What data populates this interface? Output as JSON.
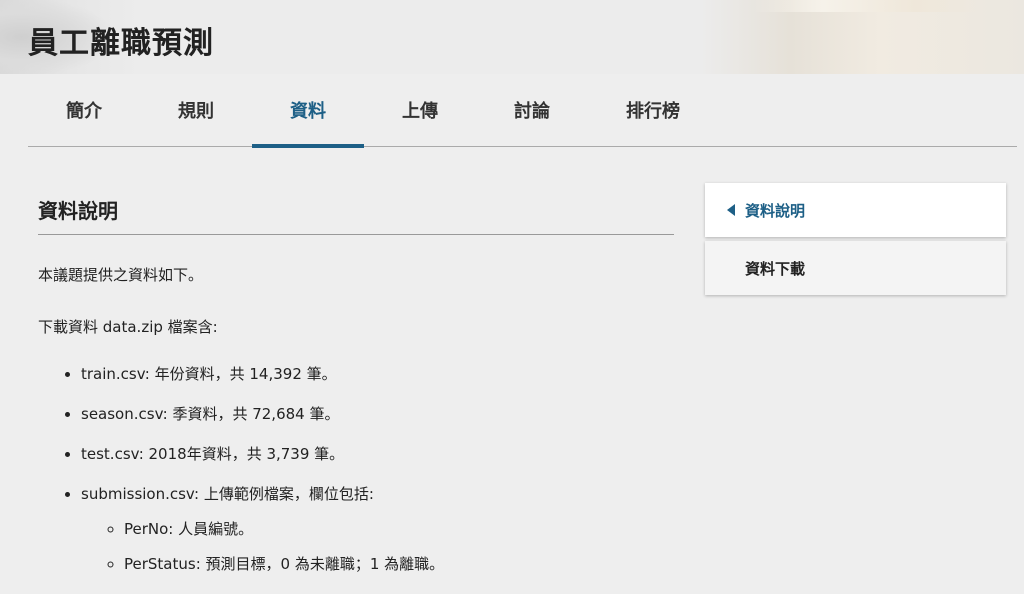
{
  "header": {
    "title": "員工離職預測"
  },
  "tabs": [
    {
      "label": "簡介",
      "active": false
    },
    {
      "label": "規則",
      "active": false
    },
    {
      "label": "資料",
      "active": true
    },
    {
      "label": "上傳",
      "active": false
    },
    {
      "label": "討論",
      "active": false
    },
    {
      "label": "排行榜",
      "active": false
    }
  ],
  "main": {
    "section_title": "資料說明",
    "intro": "本議題提供之資料如下。",
    "download_line": "下載資料 data.zip 檔案含:",
    "files": [
      "train.csv: 年份資料，共 14,392 筆。",
      "season.csv: 季資料，共 72,684 筆。",
      "test.csv: 2018年資料，共 3,739 筆。",
      "submission.csv: 上傳範例檔案，欄位包括:"
    ],
    "submission_fields": [
      "PerNo: 人員編號。",
      "PerStatus: 預測目標，0 為未離職；1 為離職。"
    ]
  },
  "toc": {
    "items": [
      {
        "label": "資料說明",
        "active": true
      },
      {
        "label": "資料下載",
        "active": false
      }
    ]
  },
  "colors": {
    "accent": "#1d5f86",
    "background": "#eeeeee",
    "text": "#333333"
  },
  "icons": {
    "toc_active": "caret-left-icon"
  }
}
